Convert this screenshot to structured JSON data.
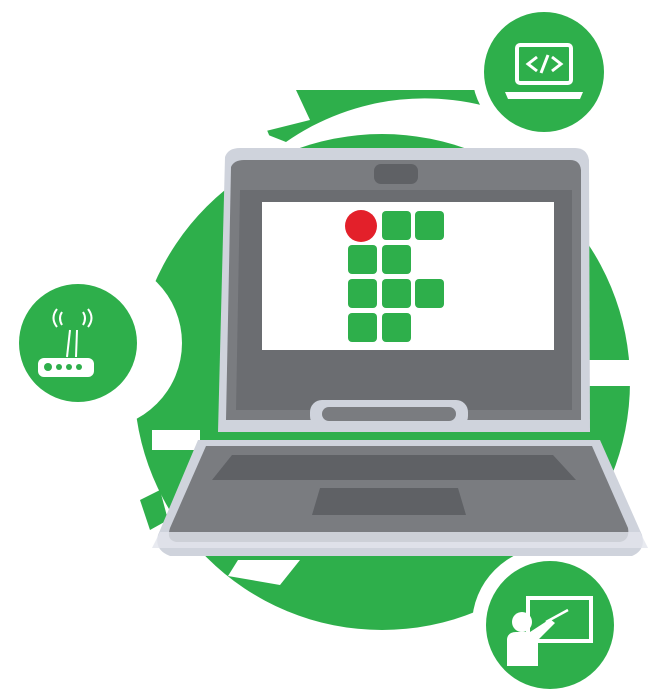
{
  "illustration": {
    "icons": [
      "laptop-code-icon",
      "wifi-router-icon",
      "teacher-board-icon"
    ],
    "logo": "if-logo"
  },
  "colors": {
    "brand_green": "#2eaf4b",
    "logo_red": "#e3202a",
    "laptop_outer": "#cfd3dc",
    "laptop_body": "#7a7c80",
    "laptop_dark": "#5f6165",
    "screen_white": "#ffffff"
  }
}
